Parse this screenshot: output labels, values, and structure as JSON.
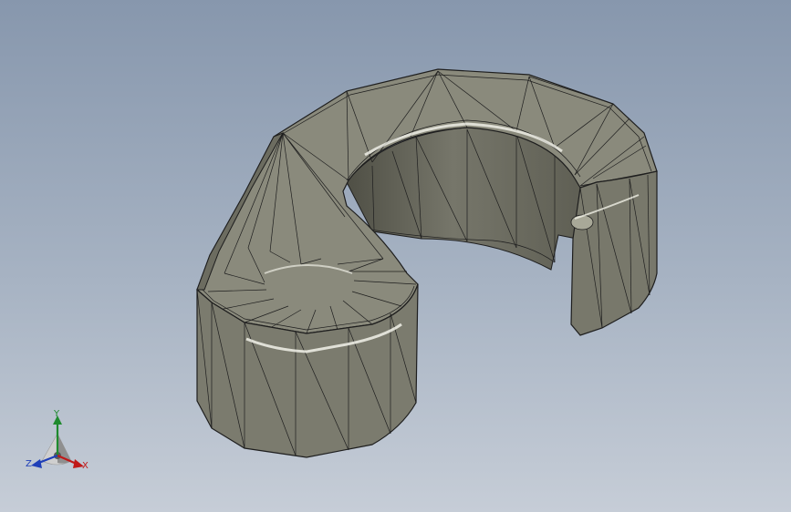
{
  "viewport": {
    "background_top": "#8797ad",
    "background_bottom": "#c6cdd7",
    "model_color": "#87877a",
    "edge_color": "#1e1e1e"
  },
  "triad": {
    "x_label": "X",
    "y_label": "Y",
    "z_label": "Z",
    "x_color": "#c01818",
    "y_color": "#1f8a2e",
    "z_color": "#1f3fb8"
  }
}
